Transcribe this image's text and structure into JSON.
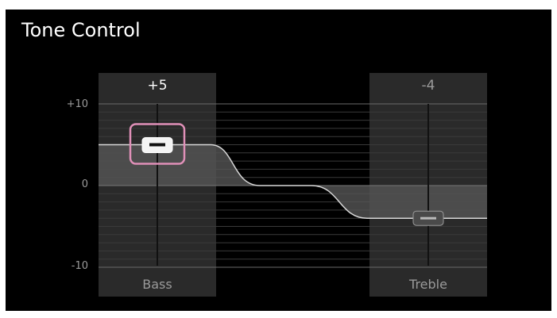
{
  "title": "Tone Control",
  "scale": {
    "top_label": "+10",
    "mid_label": "0",
    "bottom_label": "-10",
    "min": -10,
    "max": 10
  },
  "bass": {
    "label": "Bass",
    "value_label": "+5",
    "value": 5,
    "selected": true
  },
  "treble": {
    "label": "Treble",
    "value_label": "-4",
    "value": -4,
    "selected": false
  },
  "colors": {
    "background": "#000000",
    "panel": "#2a2a2a",
    "selection_frame": "#e090b8",
    "curve": "#d8d8d8",
    "fill": "#555555",
    "muted_text": "#9a9a9a"
  }
}
